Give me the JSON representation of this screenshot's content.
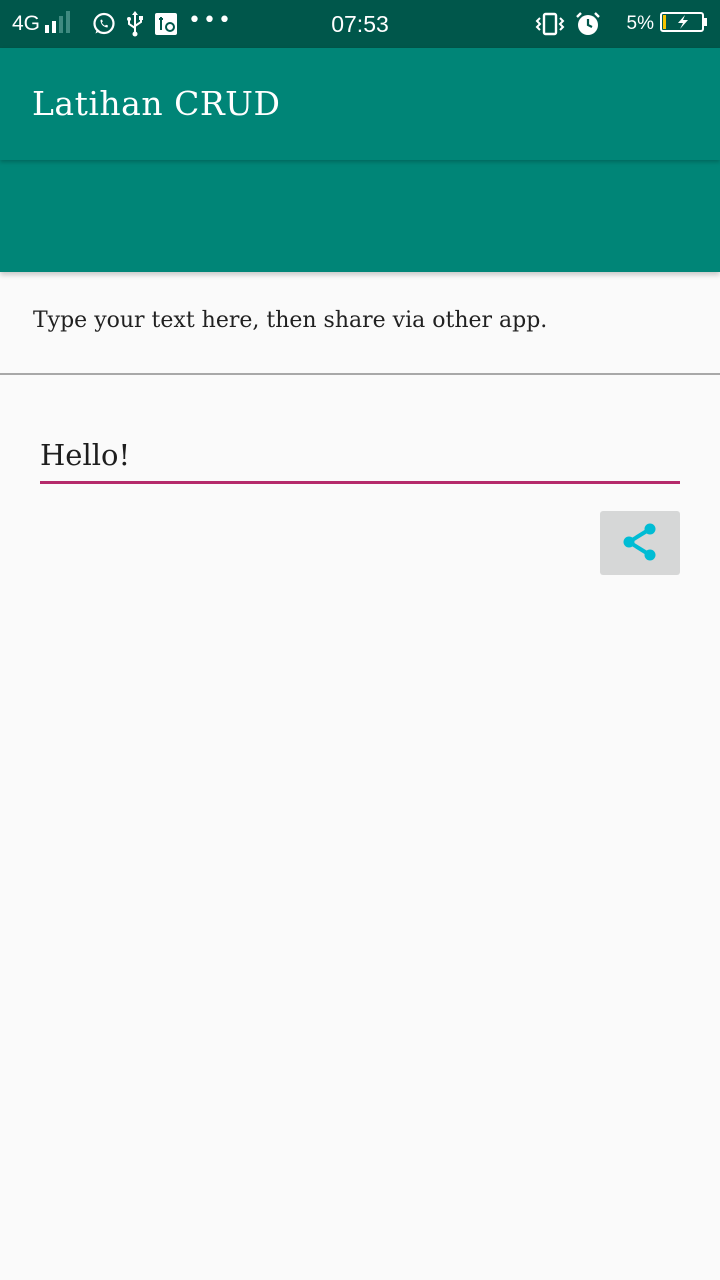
{
  "status_bar": {
    "network": "4G",
    "time": "07:53",
    "battery_percent": "5%",
    "icons": [
      "signal-icon",
      "whatsapp-icon",
      "usb-icon",
      "notification-app-icon",
      "more-icon",
      "vibrate-icon",
      "alarm-icon",
      "battery-charging-icon"
    ],
    "more": "•••"
  },
  "app_bar": {
    "title": "Latihan CRUD",
    "color": "#008577"
  },
  "content": {
    "instruction": "Type your text here, then share via other app.",
    "input_value": "Hello!",
    "input_underline_color": "#b52a6b",
    "share_button_icon": "share-icon",
    "share_icon_color": "#00bcd4"
  }
}
